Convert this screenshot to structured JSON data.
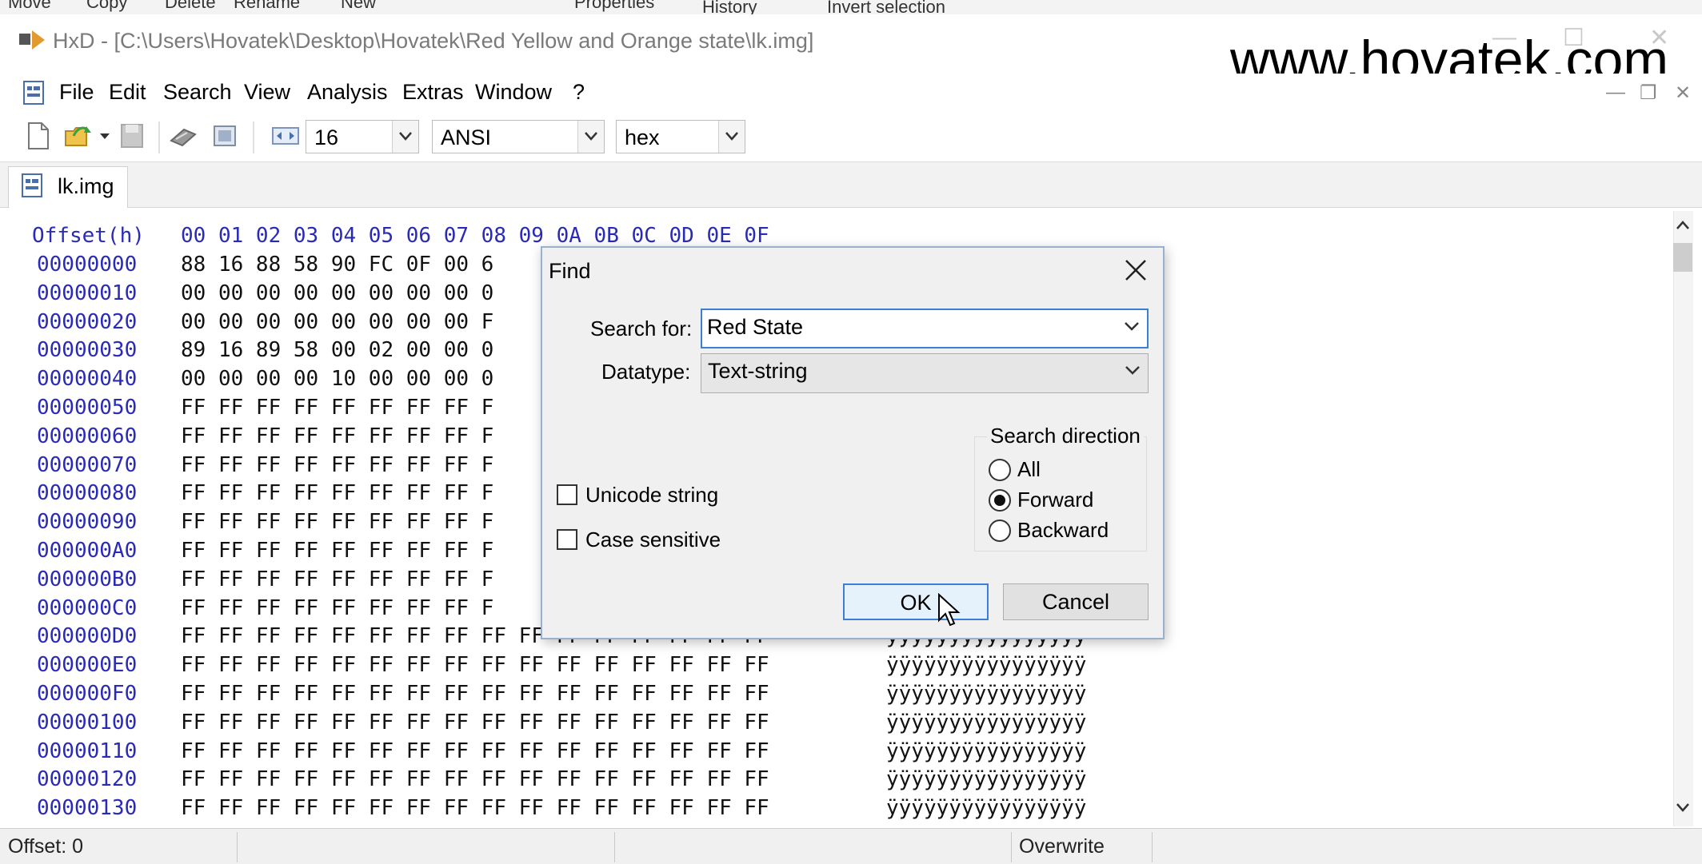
{
  "explorer_ribbon": {
    "items": [
      "Move",
      "Copy",
      "Delete",
      "Rename",
      "New",
      "Properties",
      "History",
      "Invert selection"
    ]
  },
  "window": {
    "title": "HxD - [C:\\Users\\Hovatek\\Desktop\\Hovatek\\Red Yellow and Orange state\\lk.img]",
    "watermark": "www.hovatek.com"
  },
  "menu": {
    "items": [
      "File",
      "Edit",
      "Search",
      "View",
      "Analysis",
      "Extras",
      "Window",
      "?"
    ]
  },
  "toolbar": {
    "bytes_per_row": "16",
    "charset": "ANSI",
    "offset_base": "hex"
  },
  "tab": {
    "label": "lk.img"
  },
  "hex": {
    "header_offset": "Offset(h)",
    "header_columns": "00 01 02 03 04 05 06 07 08 09 0A 0B 0C 0D 0E 0F",
    "rows": [
      {
        "offset": "00000000",
        "bytes": "88 16 88 58 90 FC 0F 00 6",
        "ascii": ""
      },
      {
        "offset": "00000010",
        "bytes": "00 00 00 00 00 00 00 00 0",
        "ascii": ""
      },
      {
        "offset": "00000020",
        "bytes": "00 00 00 00 00 00 00 00 F",
        "ascii": ""
      },
      {
        "offset": "00000030",
        "bytes": "89 16 89 58 00 02 00 00 0",
        "ascii": ""
      },
      {
        "offset": "00000040",
        "bytes": "00 00 00 00 10 00 00 00 0",
        "ascii": ""
      },
      {
        "offset": "00000050",
        "bytes": "FF FF FF FF FF FF FF FF F",
        "ascii": ""
      },
      {
        "offset": "00000060",
        "bytes": "FF FF FF FF FF FF FF FF F",
        "ascii": ""
      },
      {
        "offset": "00000070",
        "bytes": "FF FF FF FF FF FF FF FF F",
        "ascii": ""
      },
      {
        "offset": "00000080",
        "bytes": "FF FF FF FF FF FF FF FF F",
        "ascii": ""
      },
      {
        "offset": "00000090",
        "bytes": "FF FF FF FF FF FF FF FF F",
        "ascii": ""
      },
      {
        "offset": "000000A0",
        "bytes": "FF FF FF FF FF FF FF FF F",
        "ascii": ""
      },
      {
        "offset": "000000B0",
        "bytes": "FF FF FF FF FF FF FF FF F",
        "ascii": ""
      },
      {
        "offset": "000000C0",
        "bytes": "FF FF FF FF FF FF FF FF F",
        "ascii": ""
      },
      {
        "offset": "000000D0",
        "bytes": "FF FF FF FF FF FF FF FF FF FF FF FF FF FF FF FF",
        "ascii": "ÿÿÿÿÿÿÿÿÿÿÿÿÿÿÿÿ"
      },
      {
        "offset": "000000E0",
        "bytes": "FF FF FF FF FF FF FF FF FF FF FF FF FF FF FF FF",
        "ascii": "ÿÿÿÿÿÿÿÿÿÿÿÿÿÿÿÿ"
      },
      {
        "offset": "000000F0",
        "bytes": "FF FF FF FF FF FF FF FF FF FF FF FF FF FF FF FF",
        "ascii": "ÿÿÿÿÿÿÿÿÿÿÿÿÿÿÿÿ"
      },
      {
        "offset": "00000100",
        "bytes": "FF FF FF FF FF FF FF FF FF FF FF FF FF FF FF FF",
        "ascii": "ÿÿÿÿÿÿÿÿÿÿÿÿÿÿÿÿ"
      },
      {
        "offset": "00000110",
        "bytes": "FF FF FF FF FF FF FF FF FF FF FF FF FF FF FF FF",
        "ascii": "ÿÿÿÿÿÿÿÿÿÿÿÿÿÿÿÿ"
      },
      {
        "offset": "00000120",
        "bytes": "FF FF FF FF FF FF FF FF FF FF FF FF FF FF FF FF",
        "ascii": "ÿÿÿÿÿÿÿÿÿÿÿÿÿÿÿÿ"
      },
      {
        "offset": "00000130",
        "bytes": "FF FF FF FF FF FF FF FF FF FF FF FF FF FF FF FF",
        "ascii": "ÿÿÿÿÿÿÿÿÿÿÿÿÿÿÿÿ"
      }
    ]
  },
  "status": {
    "offset": "Offset: 0",
    "mode": "Overwrite"
  },
  "find_dialog": {
    "title": "Find",
    "search_label": "Search for:",
    "search_value": "Red State",
    "datatype_label": "Datatype:",
    "datatype_value": "Text-string",
    "unicode_label": "Unicode string",
    "case_label": "Case sensitive",
    "direction_title": "Search direction",
    "direction_options": [
      "All",
      "Forward",
      "Backward"
    ],
    "direction_selected": "Forward",
    "ok_label": "OK",
    "cancel_label": "Cancel"
  }
}
